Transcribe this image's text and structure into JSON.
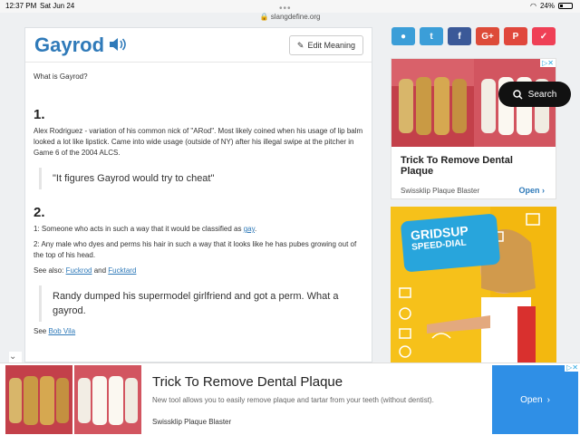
{
  "status": {
    "time": "12:37 PM",
    "date": "Sat Jun 24",
    "battery": "24%"
  },
  "browser": {
    "url": "slangdefine.org"
  },
  "page": {
    "title": "Gayrod",
    "edit_label": "Edit Meaning",
    "what_is": "What is Gayrod?",
    "sections": [
      {
        "number": "1.",
        "definition": "Alex Rodriguez - variation of his common nick of \"ARod\". Most likely coined when his usage of lip balm looked a lot like lipstick. Came into wide usage (outside of NY) after his illegal swipe at the pitcher in Game 6 of the 2004 ALCS.",
        "quote": "\"It figures Gayrod would try to cheat\""
      },
      {
        "number": "2.",
        "def1_prefix": "1: Someone who acts in such a way that it would be classified as ",
        "def1_link": "gay",
        "def1_suffix": ".",
        "def2": "2: Any male who dyes and perms his hair in such a way that it looks like he has pubes growing out of the top of his head.",
        "see_also_prefix": "See also: ",
        "see_also_link1": "Fuckrod",
        "see_also_and": " and ",
        "see_also_link2": "Fucktard",
        "quote": "Randy dumped his supermodel girlfriend and got a perm. What a gayrod.",
        "see_prefix": "See ",
        "see_link": "Bob Vila"
      }
    ]
  },
  "social": [
    {
      "name": "reddit",
      "color": "#3b9ed8",
      "glyph": "●"
    },
    {
      "name": "twitter",
      "color": "#3b9ed8",
      "glyph": "t"
    },
    {
      "name": "facebook",
      "color": "#3b5998",
      "glyph": "f"
    },
    {
      "name": "google-plus",
      "color": "#dd4b39",
      "glyph": "G+"
    },
    {
      "name": "pinterest",
      "color": "#e0473c",
      "glyph": "P"
    },
    {
      "name": "pocket",
      "color": "#ef4056",
      "glyph": "✓"
    }
  ],
  "ads": {
    "side": {
      "title": "Trick To Remove Dental Plaque",
      "source": "Swissklip Plaque Blaster",
      "open": "Open"
    },
    "search_label": "Search",
    "gridsup": {
      "line1": "GRIDSUP",
      "line2": "SPEED-DIAL"
    },
    "bottom": {
      "title": "Trick To Remove Dental Plaque",
      "desc": "New tool allows you to easily remove plaque and tartar from your teeth (without dentist).",
      "source": "Swissklip Plaque Blaster",
      "open": "Open"
    }
  },
  "colors": {
    "brand": "#2f7ab9",
    "ad_yellow": "#f6c11a",
    "open_blue": "#2f8fe6"
  }
}
